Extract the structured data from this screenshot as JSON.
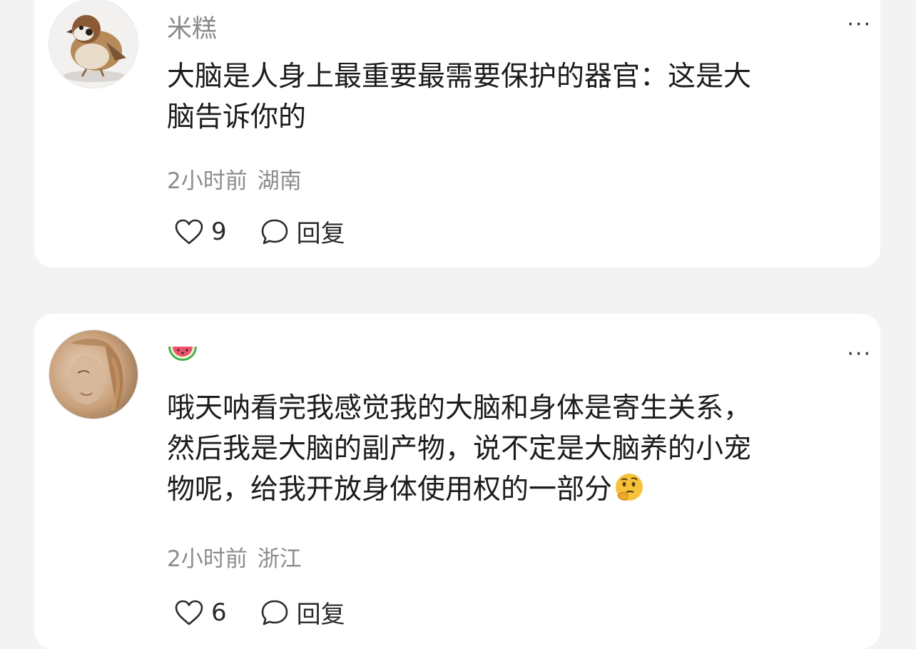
{
  "comments": [
    {
      "username": "米糕",
      "content_line1": "大脑是人身上最重要最需要保护的器官：这是大",
      "content_line2": "脑告诉你的",
      "time": "2小时前",
      "location": "湖南",
      "likes": "9",
      "reply_label": "回复",
      "more_label": "···",
      "avatar_icon": "sparrow-avatar"
    },
    {
      "username_icon": "watermelon-icon",
      "content_line1": "哦天呐看完我感觉我的大脑和身体是寄生关系，",
      "content_line2": "然后我是大脑的副产物，说不定是大脑养的小宠",
      "content_line3": "物呢，给我开放身体使用权的一部分",
      "content_emoji": "thinking-face-icon",
      "time": "2小时前",
      "location": "浙江",
      "likes": "6",
      "reply_label": "回复",
      "more_label": "···",
      "avatar_icon": "portrait-avatar"
    }
  ],
  "colors": {
    "muted": "#8a8a8a",
    "text": "#1c1c1c",
    "card": "#ffffff",
    "background": "#f3f3f3"
  }
}
